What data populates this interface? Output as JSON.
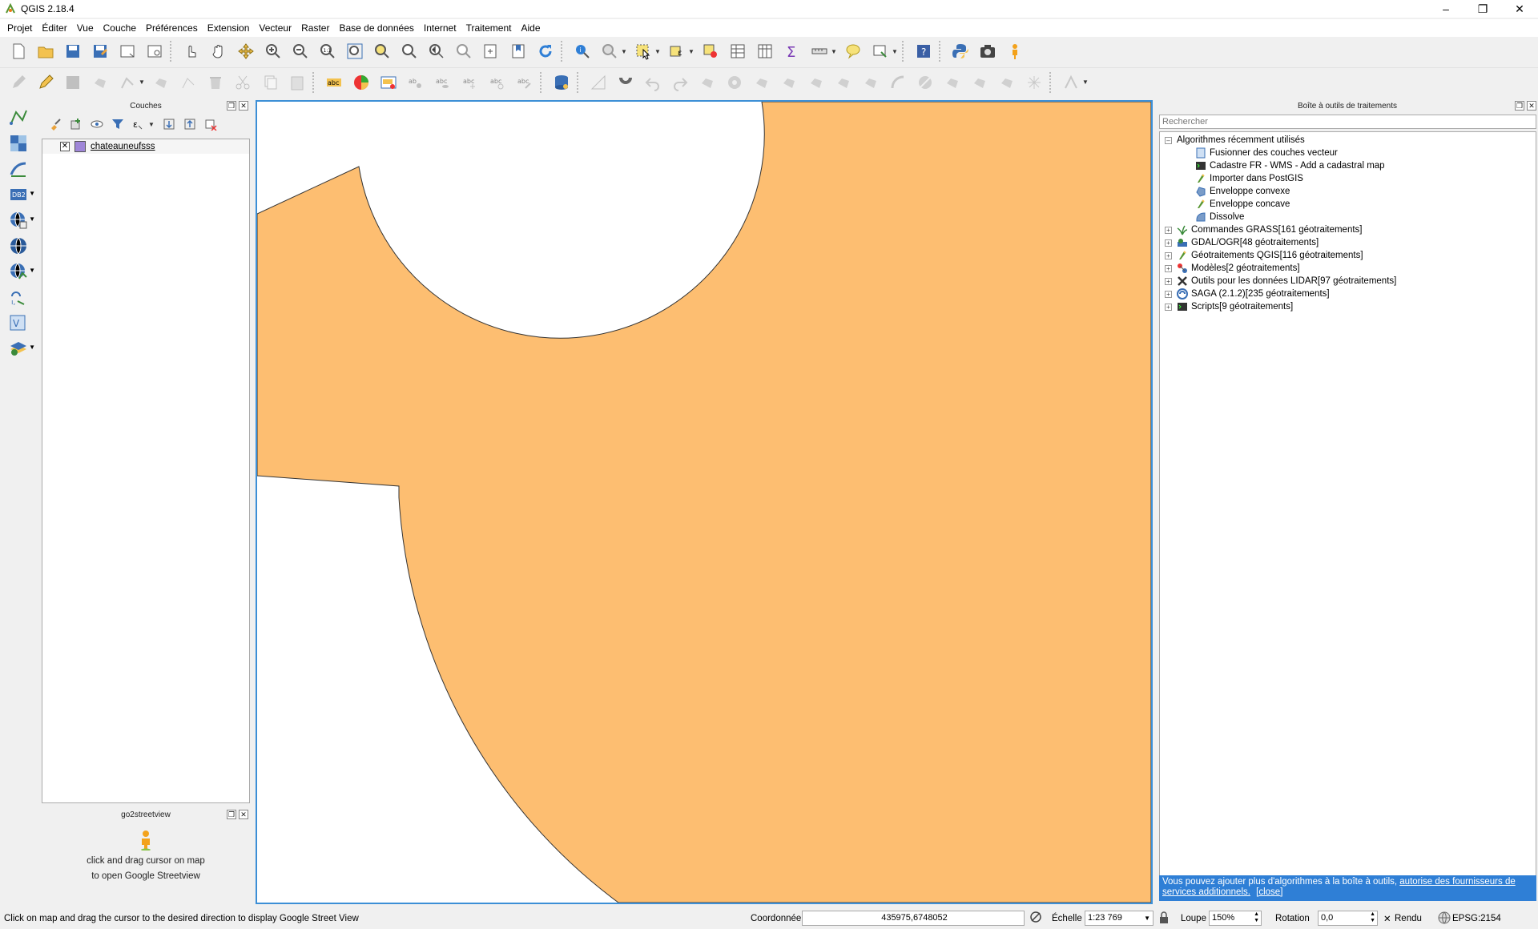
{
  "window": {
    "title": "QGIS 2.18.4"
  },
  "menu": [
    "Projet",
    "Éditer",
    "Vue",
    "Couche",
    "Préférences",
    "Extension",
    "Vecteur",
    "Raster",
    "Base de données",
    "Internet",
    "Traitement",
    "Aide"
  ],
  "layers_panel": {
    "title": "Couches",
    "layers": [
      {
        "name": "chateauneufsss",
        "visible": true,
        "color": "#9f86d8"
      }
    ]
  },
  "go2streetview": {
    "title": "go2streetview",
    "line1": "click and drag cursor on map",
    "line2": "to open Google Streetview"
  },
  "map": {
    "fill_color": "#fdbe71",
    "background": "#ffffff"
  },
  "processing": {
    "title": "Boîte à outils de traitements",
    "search_placeholder": "Rechercher",
    "recent": {
      "label": "Algorithmes récemment utilisés",
      "items": [
        "Fusionner des couches vecteur",
        "Cadastre FR - WMS - Add a cadastral map",
        "Importer dans PostGIS",
        "Enveloppe convexe",
        "Enveloppe concave",
        "Dissolve"
      ]
    },
    "providers": [
      "Commandes GRASS[161 géotraitements]",
      "GDAL/OGR[48 géotraitements]",
      "Géotraitements QGIS[116 géotraitements]",
      "Modèles[2 géotraitements]",
      "Outils pour les données LIDAR[97 géotraitements]",
      "SAGA (2.1.2)[235 géotraitements]",
      "Scripts[9 géotraitements]"
    ],
    "info_text": "Vous pouvez ajouter plus d'algorithmes à la boîte à outils,",
    "info_link": "autorise des fournisseurs de services additionnels.",
    "info_close": "[close]"
  },
  "status": {
    "message": "Click on map and drag the cursor to the desired direction to display Google Street View",
    "coord_label": "Coordonnée",
    "coord_value": "435975,6748052",
    "scale_label": "Échelle",
    "scale_value": "1:23 769",
    "magnifier_label": "Loupe",
    "magnifier_value": "150%",
    "rotation_label": "Rotation",
    "rotation_value": "0,0",
    "render_label": "Rendu",
    "crs": "EPSG:2154"
  }
}
